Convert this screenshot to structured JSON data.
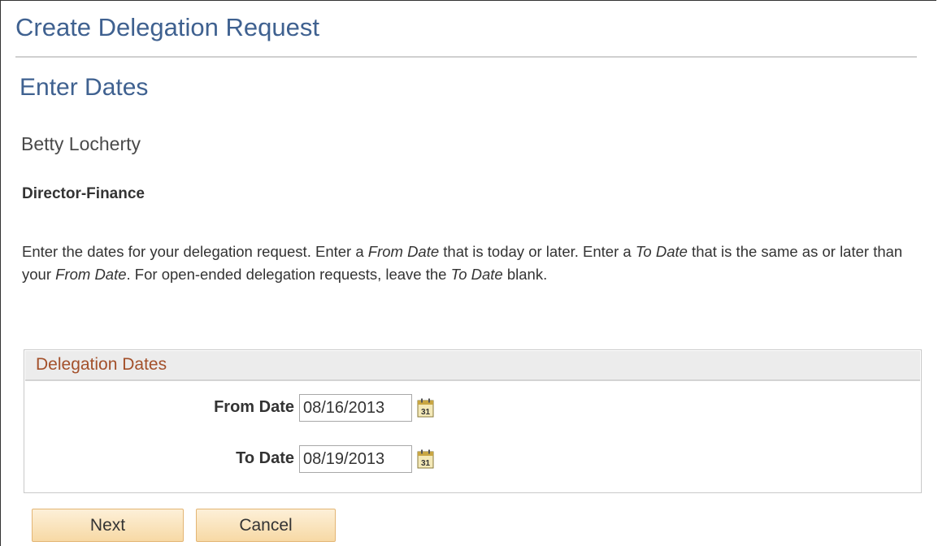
{
  "page": {
    "title": "Create Delegation Request",
    "section_title": "Enter Dates"
  },
  "person": {
    "name": "Betty Locherty",
    "job_title": "Director-Finance"
  },
  "instructions": {
    "part1": "Enter the dates for your delegation request. Enter a ",
    "em1": "From Date",
    "part2": " that is today or later. Enter a ",
    "em2": "To Date",
    "part3": " that is the same as or later than your ",
    "em3": "From Date",
    "part4": ". For open-ended delegation requests, leave the ",
    "em4": "To Date",
    "part5": " blank."
  },
  "delegation_dates": {
    "header": "Delegation Dates",
    "from_label": "From Date",
    "from_value": "08/16/2013",
    "to_label": "To Date",
    "to_value": "08/19/2013",
    "calendar_icon": "calendar-icon",
    "calendar_day": "31"
  },
  "buttons": {
    "next_label": "Next",
    "cancel_label": "Cancel"
  },
  "colors": {
    "title_blue": "#3f6190",
    "group_header_text": "#a3502a",
    "button_fill": "#f7d9a5",
    "button_border": "#e3b574"
  }
}
